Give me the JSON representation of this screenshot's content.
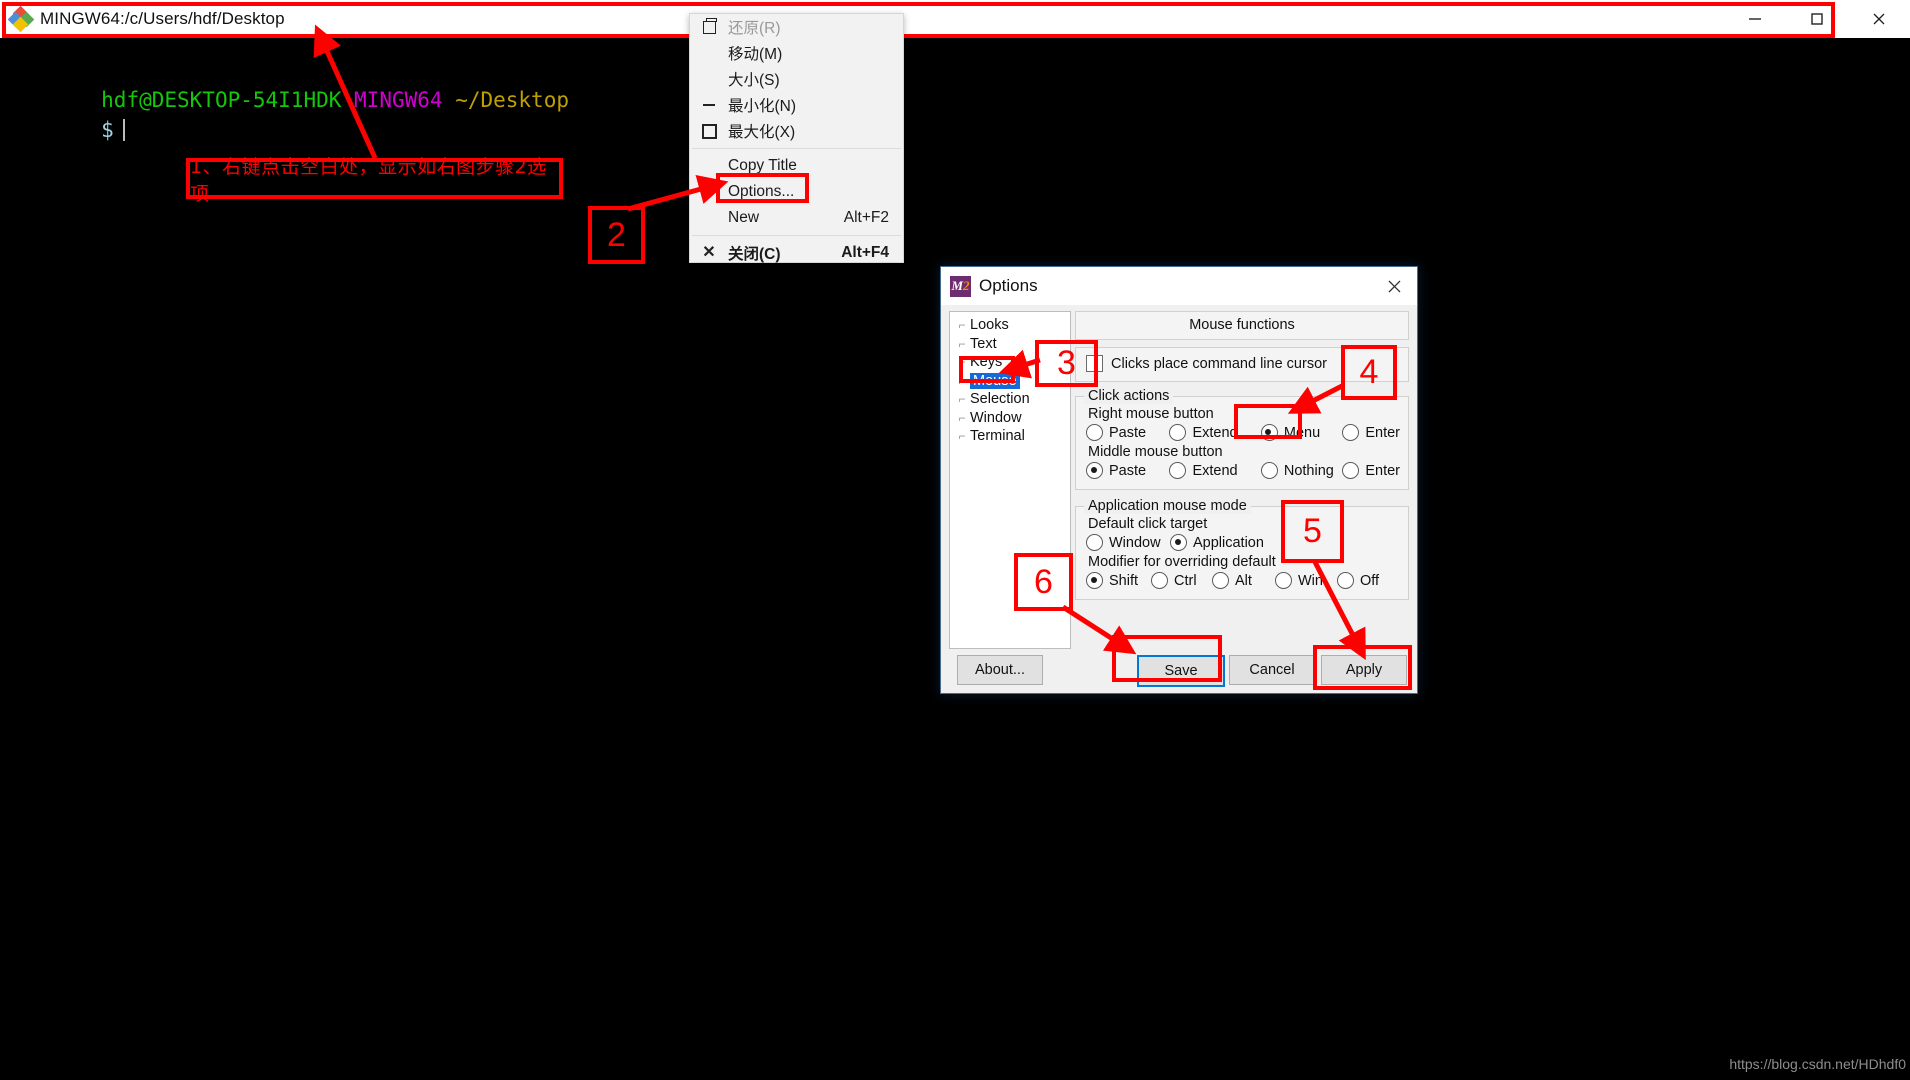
{
  "terminal": {
    "title": "MINGW64:/c/Users/hdf/Desktop",
    "icon": "mingw-diamond-icon",
    "prompt_user": "hdf@DESKTOP-54I1HDK",
    "prompt_shell": "MINGW64",
    "prompt_path": "~/Desktop",
    "prompt_symbol": "$",
    "titlebar_buttons": {
      "minimize": "minimize",
      "maximize": "maximize",
      "close": "close"
    }
  },
  "context_menu": {
    "items": [
      {
        "label": "还原(R)",
        "accel": "",
        "glyph": "restore-icon",
        "disabled": true,
        "bold": false
      },
      {
        "label": "移动(M)",
        "accel": "",
        "glyph": "",
        "disabled": false,
        "bold": false
      },
      {
        "label": "大小(S)",
        "accel": "",
        "glyph": "",
        "disabled": false,
        "bold": false
      },
      {
        "label": "最小化(N)",
        "accel": "",
        "glyph": "minimize-icon",
        "disabled": false,
        "bold": false
      },
      {
        "label": "最大化(X)",
        "accel": "",
        "glyph": "maximize-icon",
        "disabled": false,
        "bold": false
      },
      {
        "label": "Copy Title",
        "accel": "",
        "glyph": "",
        "disabled": false,
        "bold": false
      },
      {
        "label": "Options...",
        "accel": "",
        "glyph": "",
        "disabled": false,
        "bold": false
      },
      {
        "label": "New",
        "accel": "Alt+F2",
        "glyph": "",
        "disabled": false,
        "bold": false
      },
      {
        "label": "关闭(C)",
        "accel": "Alt+F4",
        "glyph": "close-icon",
        "disabled": false,
        "bold": true
      }
    ]
  },
  "dialog": {
    "title": "Options",
    "icon_text": "M",
    "icon_accent": "2",
    "close_label": "×",
    "tree": [
      {
        "label": "Looks",
        "selected": false
      },
      {
        "label": "Text",
        "selected": false
      },
      {
        "label": "Keys",
        "selected": false
      },
      {
        "label": "Mouse",
        "selected": true
      },
      {
        "label": "Selection",
        "selected": false
      },
      {
        "label": "Window",
        "selected": false
      },
      {
        "label": "Terminal",
        "selected": false
      }
    ],
    "panel_header": "Mouse functions",
    "checkbox": {
      "label": "Clicks place command line cursor",
      "checked": false
    },
    "click_actions": {
      "legend": "Click actions",
      "right_mouse_label": "Right mouse button",
      "right_mouse_options": [
        {
          "label": "Paste",
          "selected": false
        },
        {
          "label": "Extend",
          "selected": false
        },
        {
          "label": "Menu",
          "selected": true
        },
        {
          "label": "Enter",
          "selected": false
        }
      ],
      "middle_mouse_label": "Middle mouse button",
      "middle_mouse_options": [
        {
          "label": "Paste",
          "selected": true
        },
        {
          "label": "Extend",
          "selected": false
        },
        {
          "label": "Nothing",
          "selected": false
        },
        {
          "label": "Enter",
          "selected": false
        }
      ]
    },
    "app_mouse_mode": {
      "legend": "Application mouse mode",
      "default_click_target_label": "Default click target",
      "default_click_target_options": [
        {
          "label": "Window",
          "selected": false
        },
        {
          "label": "Application",
          "selected": true
        }
      ],
      "modifier_label": "Modifier for overriding default",
      "modifier_options": [
        {
          "label": "Shift",
          "selected": true
        },
        {
          "label": "Ctrl",
          "selected": false
        },
        {
          "label": "Alt",
          "selected": false
        },
        {
          "label": "Win",
          "selected": false
        },
        {
          "label": "Off",
          "selected": false
        }
      ]
    },
    "buttons": {
      "about": "About...",
      "save": "Save",
      "cancel": "Cancel",
      "apply": "Apply"
    }
  },
  "annotations": {
    "step1_text": "1、右键点击空白处，显示如右图步骤2选项",
    "step2": "2",
    "step3": "3",
    "step4": "4",
    "step5": "5",
    "step6": "6",
    "accent_color": "#ff0000"
  },
  "watermark": "https://blog.csdn.net/HDhdf0"
}
